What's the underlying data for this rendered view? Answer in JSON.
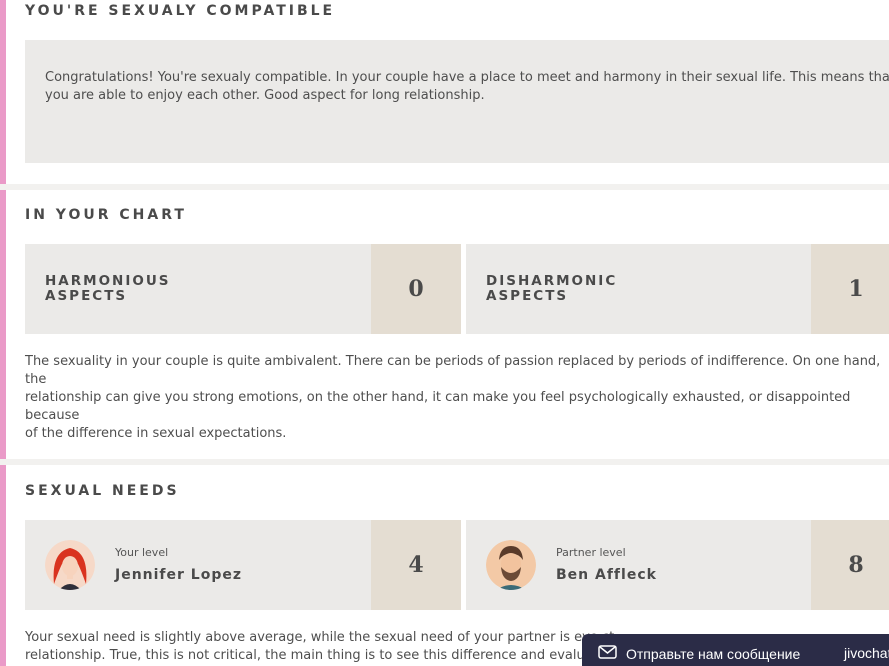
{
  "compatibility": {
    "title": "YOU'RE SEXUALY COMPATIBLE",
    "text": "Congratulations! You're sexualy compatible. In your couple have a place to meet and harmony in their sexual life. This means that you are able to enjoy each other. Good aspect for long relationship."
  },
  "chart": {
    "title": "IN YOUR CHART",
    "harmonious": {
      "label_line1": "HARMONIOUS",
      "label_line2": "ASPECTS",
      "value": "0"
    },
    "disharmonic": {
      "label_line1": "DISHARMONIC",
      "label_line2": "ASPECTS",
      "value": "1"
    },
    "text": "The sexuality in your couple is quite ambivalent. There can be periods of passion replaced by periods of indifference. On one hand, the\nrelationship can give you strong emotions, on the other hand, it can make you feel psychologically exhausted, or disappointed because\nof the difference in sexual expectations."
  },
  "needs": {
    "title": "SEXUAL NEEDS",
    "you": {
      "label": "Your level",
      "name": "Jennifer Lopez",
      "value": "4",
      "avatar_icon": "woman-avatar-icon"
    },
    "partner": {
      "label": "Partner level",
      "name": "Ben Affleck",
      "value": "8",
      "avatar_icon": "man-avatar-icon"
    },
    "text": "Your sexual need is slightly above average, while the sexual need of your partner is eve                                               ct\nrelationship. True, this is not critical, the main thing is to see this difference and evalua"
  },
  "chat": {
    "label": "Отправьте нам сообщение",
    "brand": "jivochat",
    "icon": "envelope-icon"
  }
}
